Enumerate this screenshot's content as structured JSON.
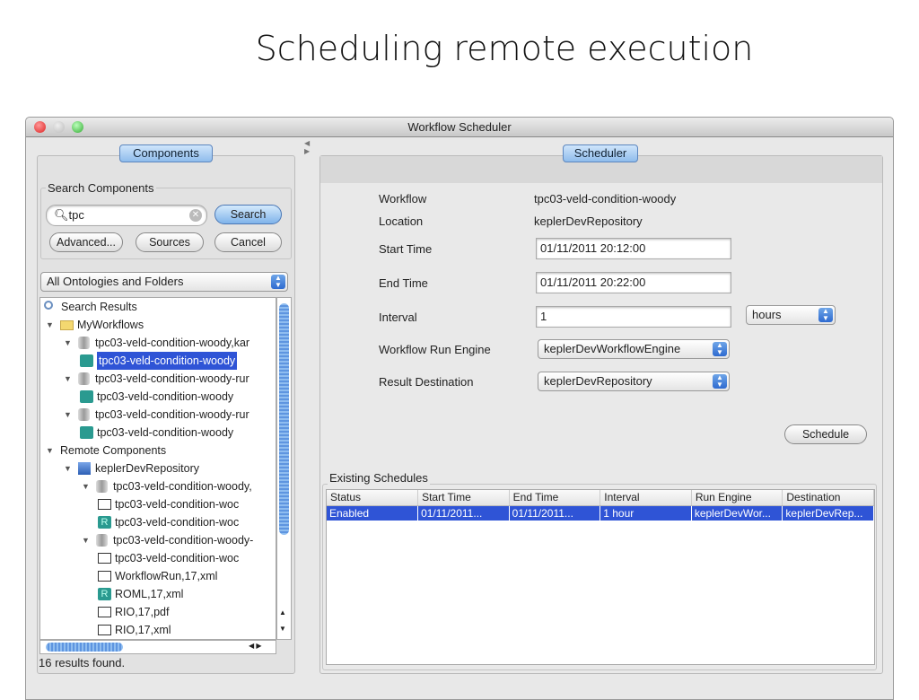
{
  "slide_title": "Scheduling remote execution",
  "window_title": "Workflow Scheduler",
  "left": {
    "tab": "Components",
    "search_group": "Search Components",
    "search_value": "tpc",
    "search_btn": "Search",
    "advanced_btn": "Advanced...",
    "sources_btn": "Sources",
    "cancel_btn": "Cancel",
    "scope_select": "All Ontologies and Folders",
    "tree": [
      {
        "depth": 0,
        "icon": "search",
        "label": "Search Results",
        "expander": false
      },
      {
        "depth": 0,
        "icon": "folder",
        "label": "MyWorkflows",
        "expander": true
      },
      {
        "depth": 1,
        "icon": "db",
        "label": "tpc03-veld-condition-woody,kar",
        "expander": true
      },
      {
        "depth": 2,
        "icon": "teal",
        "label": "tpc03-veld-condition-woody",
        "expander": false,
        "selected": true
      },
      {
        "depth": 1,
        "icon": "db",
        "label": "tpc03-veld-condition-woody-rur",
        "expander": true
      },
      {
        "depth": 2,
        "icon": "teal",
        "label": "tpc03-veld-condition-woody",
        "expander": false
      },
      {
        "depth": 1,
        "icon": "db",
        "label": "tpc03-veld-condition-woody-rur",
        "expander": true
      },
      {
        "depth": 2,
        "icon": "teal",
        "label": "tpc03-veld-condition-woody",
        "expander": false
      },
      {
        "depth": 0,
        "icon": "none",
        "label": "Remote Components",
        "expander": true
      },
      {
        "depth": 1,
        "icon": "server",
        "label": "keplerDevRepository",
        "expander": true
      },
      {
        "depth": 2,
        "icon": "db",
        "label": "tpc03-veld-condition-woody,",
        "expander": true
      },
      {
        "depth": 3,
        "icon": "box",
        "label": "tpc03-veld-condition-woc",
        "expander": false
      },
      {
        "depth": 3,
        "icon": "teal-r",
        "label": "tpc03-veld-condition-woc",
        "expander": false
      },
      {
        "depth": 2,
        "icon": "db",
        "label": "tpc03-veld-condition-woody-",
        "expander": true
      },
      {
        "depth": 3,
        "icon": "box",
        "label": "tpc03-veld-condition-woc",
        "expander": false
      },
      {
        "depth": 3,
        "icon": "box",
        "label": "WorkflowRun,17,xml",
        "expander": false
      },
      {
        "depth": 3,
        "icon": "teal-r",
        "label": "ROML,17,xml",
        "expander": false
      },
      {
        "depth": 3,
        "icon": "box",
        "label": "RIO,17,pdf",
        "expander": false
      },
      {
        "depth": 3,
        "icon": "box",
        "label": "RIO,17,xml",
        "expander": false
      }
    ],
    "status": "16 results found."
  },
  "right": {
    "tab": "Scheduler",
    "workflow_label": "Workflow",
    "workflow_value": "tpc03-veld-condition-woody",
    "location_label": "Location",
    "location_value": "keplerDevRepository",
    "start_label": "Start Time",
    "start_value": "01/11/2011 20:12:00",
    "end_label": "End Time",
    "end_value": "01/11/2011 20:22:00",
    "interval_label": "Interval",
    "interval_value": "1",
    "interval_unit": "hours",
    "engine_label": "Workflow Run Engine",
    "engine_value": "keplerDevWorkflowEngine",
    "dest_label": "Result Destination",
    "dest_value": "keplerDevRepository",
    "schedule_btn": "Schedule",
    "existing_label": "Existing Schedules",
    "columns": [
      "Status",
      "Start Time",
      "End Time",
      "Interval",
      "Run Engine",
      "Destination"
    ],
    "rows": [
      [
        "Enabled",
        "01/11/2011...",
        "01/11/2011...",
        "1 hour",
        "keplerDevWor...",
        "keplerDevRep..."
      ]
    ]
  }
}
